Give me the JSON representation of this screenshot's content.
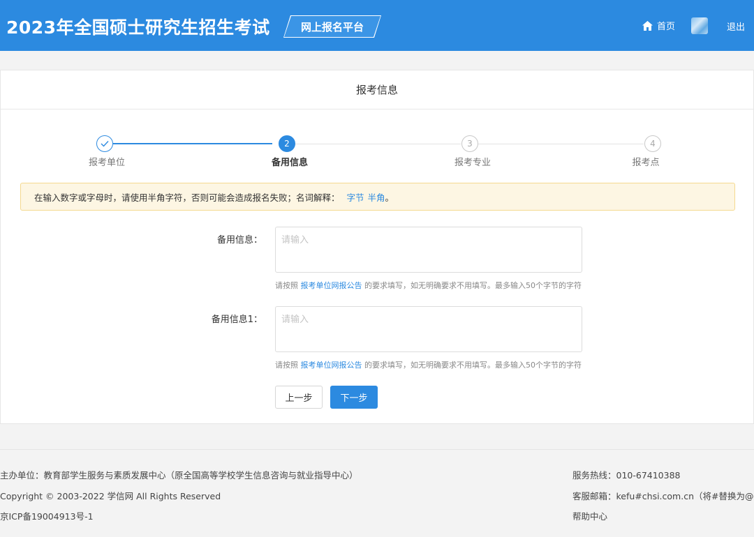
{
  "header": {
    "title": "2023年全国硕士研究生招生考试",
    "platform_tag": "网上报名平台",
    "home_label": "首页",
    "logout_label": "退出"
  },
  "card": {
    "title": "报考信息"
  },
  "steps": [
    {
      "number": "✓",
      "label": "报考单位",
      "state": "done"
    },
    {
      "number": "2",
      "label": "备用信息",
      "state": "active"
    },
    {
      "number": "3",
      "label": "报考专业",
      "state": "todo"
    },
    {
      "number": "4",
      "label": "报考点",
      "state": "todo"
    }
  ],
  "notice": {
    "text": "在输入数字或字母时，请使用半角字符，否则可能会造成报名失败；名词解释：",
    "link_bytes": "字节",
    "link_halfwidth": "半角",
    "suffix": "。"
  },
  "form": {
    "field1": {
      "label": "备用信息：",
      "placeholder": "请输入",
      "value": "",
      "hint_prefix": "请按照",
      "hint_link": "报考单位网报公告",
      "hint_suffix": "的要求填写，如无明确要求不用填写。最多输入50个字节的字符"
    },
    "field2": {
      "label": "备用信息1：",
      "placeholder": "请输入",
      "value": "",
      "hint_prefix": "请按照",
      "hint_link": "报考单位网报公告",
      "hint_suffix": "的要求填写，如无明确要求不用填写。最多输入50个字节的字符"
    },
    "prev_label": "上一步",
    "next_label": "下一步"
  },
  "footer": {
    "organizer": "主办单位：教育部学生服务与素质发展中心（原全国高等学校学生信息咨询与就业指导中心）",
    "copyright": "Copyright © 2003-2022 学信网 All Rights Reserved",
    "icp": "京ICP备19004913号-1",
    "hotline": "服务热线：010-67410388",
    "email": "客服邮箱：kefu#chsi.com.cn（将#替换为@）",
    "help": "帮助中心"
  },
  "colors": {
    "brand_blue": "#2c8ae0",
    "notice_bg": "#fdf6e3",
    "notice_border": "#f4d98f"
  },
  "icons": {
    "home": "home-icon",
    "avatar": "user-avatar",
    "step_done": "check-icon"
  }
}
